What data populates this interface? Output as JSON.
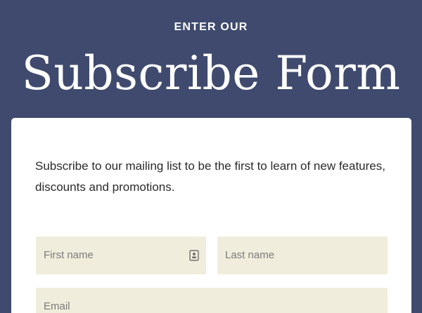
{
  "header": {
    "eyebrow": "ENTER OUR",
    "title": "Subscribe Form"
  },
  "form": {
    "intro": "Subscribe to our mailing list to be the first to learn of new features, discounts and promotions.",
    "first_name": {
      "placeholder": "First name",
      "value": "",
      "icon": "contact-card-icon"
    },
    "last_name": {
      "placeholder": "Last name",
      "value": ""
    },
    "email": {
      "placeholder": "Email",
      "value": ""
    }
  },
  "colors": {
    "background": "#3f4a6e",
    "card": "#ffffff",
    "field": "#f1eddc",
    "text": "#2a2a2a",
    "placeholder": "#7b7b7b"
  }
}
